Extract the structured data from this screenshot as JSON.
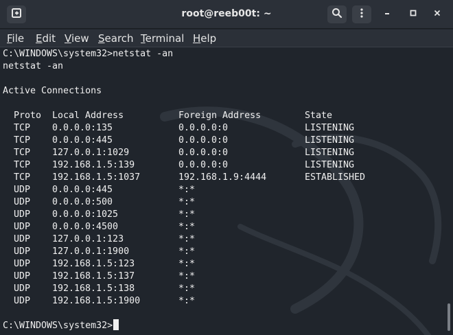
{
  "window": {
    "title": "root@reeb00t: ~",
    "icons": {
      "new_tab": "new-tab-icon",
      "search": "search-icon",
      "menu": "kebab-menu-icon",
      "minimize": "minimize-icon",
      "maximize": "maximize-icon",
      "close": "close-icon"
    }
  },
  "menubar": {
    "items": [
      {
        "label": "File",
        "accel": "F",
        "rest": "ile"
      },
      {
        "label": "Edit",
        "accel": "E",
        "rest": "dit"
      },
      {
        "label": "View",
        "accel": "V",
        "rest": "iew"
      },
      {
        "label": "Search",
        "accel": "S",
        "rest": "earch"
      },
      {
        "label": "Terminal",
        "accel": "T",
        "rest": "erminal"
      },
      {
        "label": "Help",
        "accel": "H",
        "rest": "elp"
      }
    ]
  },
  "terminal": {
    "prompt_command": "C:\\WINDOWS\\system32>netstat -an",
    "echo": "netstat -an",
    "section_title": "Active Connections",
    "headers": {
      "proto": "Proto",
      "local": "Local Address",
      "foreign": "Foreign Address",
      "state": "State"
    },
    "rows": [
      {
        "proto": "TCP",
        "local": "0.0.0.0:135",
        "foreign": "0.0.0.0:0",
        "state": "LISTENING"
      },
      {
        "proto": "TCP",
        "local": "0.0.0.0:445",
        "foreign": "0.0.0.0:0",
        "state": "LISTENING"
      },
      {
        "proto": "TCP",
        "local": "127.0.0.1:1029",
        "foreign": "0.0.0.0:0",
        "state": "LISTENING"
      },
      {
        "proto": "TCP",
        "local": "192.168.1.5:139",
        "foreign": "0.0.0.0:0",
        "state": "LISTENING"
      },
      {
        "proto": "TCP",
        "local": "192.168.1.5:1037",
        "foreign": "192.168.1.9:4444",
        "state": "ESTABLISHED"
      },
      {
        "proto": "UDP",
        "local": "0.0.0.0:445",
        "foreign": "*:*",
        "state": ""
      },
      {
        "proto": "UDP",
        "local": "0.0.0.0:500",
        "foreign": "*:*",
        "state": ""
      },
      {
        "proto": "UDP",
        "local": "0.0.0.0:1025",
        "foreign": "*:*",
        "state": ""
      },
      {
        "proto": "UDP",
        "local": "0.0.0.0:4500",
        "foreign": "*:*",
        "state": ""
      },
      {
        "proto": "UDP",
        "local": "127.0.0.1:123",
        "foreign": "*:*",
        "state": ""
      },
      {
        "proto": "UDP",
        "local": "127.0.0.1:1900",
        "foreign": "*:*",
        "state": ""
      },
      {
        "proto": "UDP",
        "local": "192.168.1.5:123",
        "foreign": "*:*",
        "state": ""
      },
      {
        "proto": "UDP",
        "local": "192.168.1.5:137",
        "foreign": "*:*",
        "state": ""
      },
      {
        "proto": "UDP",
        "local": "192.168.1.5:138",
        "foreign": "*:*",
        "state": ""
      },
      {
        "proto": "UDP",
        "local": "192.168.1.5:1900",
        "foreign": "*:*",
        "state": ""
      }
    ],
    "final_prompt": "C:\\WINDOWS\\system32>"
  },
  "colors": {
    "background": "#20252c",
    "titlebar": "#2b3038",
    "text": "#f0f0f0"
  }
}
